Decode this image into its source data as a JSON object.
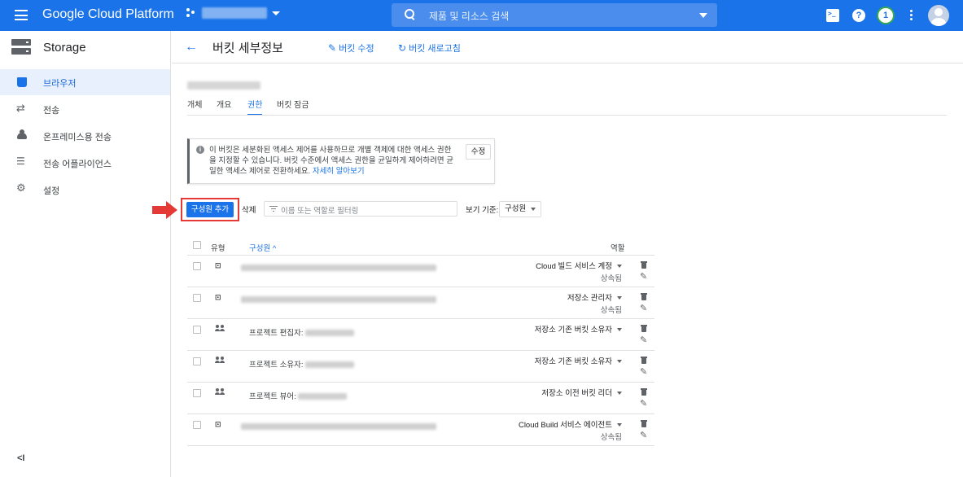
{
  "topbar": {
    "brand": "Google Cloud Platform",
    "search_placeholder": "제품 및 리소스 검색",
    "notification_count": "1",
    "help_label": "?"
  },
  "sidebar": {
    "title": "Storage",
    "items": [
      {
        "label": "브라우저",
        "icon": "bucket-icon",
        "active": true
      },
      {
        "label": "전송",
        "icon": "transfer-icon"
      },
      {
        "label": "온프레미스용 전송",
        "icon": "cloud-upload-icon"
      },
      {
        "label": "전송 어플라이언스",
        "icon": "list-icon"
      },
      {
        "label": "설정",
        "icon": "gear-icon"
      }
    ],
    "collapse_label": "<I"
  },
  "header": {
    "title": "버킷 세부정보",
    "edit_label": "버킷 수정",
    "refresh_label": "버킷 새로고침"
  },
  "tabs": [
    {
      "label": "개체"
    },
    {
      "label": "개요"
    },
    {
      "label": "권한",
      "active": true
    },
    {
      "label": "버킷 잠금"
    }
  ],
  "info": {
    "text": "이 버킷은 세분화된 액세스 제어를 사용하므로 개별 객체에 대한 액세스 권한을 지정할 수 있습니다. 버킷 수준에서 액세스 권한을 균일하게 제어하려면 균일한 액세스 제어로 전환하세요.",
    "link": "자세히 알아보기",
    "edit_button": "수정"
  },
  "toolbar": {
    "add_member": "구성원 추가",
    "delete": "삭제",
    "filter_placeholder": "이름 또는 역할로 필터링",
    "view_label": "보기 기준:",
    "view_value": "구성원"
  },
  "table": {
    "headers": {
      "type": "유형",
      "member": "구성원",
      "sort_indicator": "^",
      "role": "역할"
    },
    "rows": [
      {
        "type": "service-account",
        "member": "",
        "role": "Cloud 빌드 서비스 계정",
        "inherited": "상속됨"
      },
      {
        "type": "service-account",
        "member": "",
        "role": "저장소 관리자",
        "inherited": "상속됨"
      },
      {
        "type": "group",
        "member": "프로젝트 편집자:",
        "role": "저장소 기존 버킷 소유자",
        "inherited": ""
      },
      {
        "type": "group",
        "member": "프로젝트 소유자:",
        "role": "저장소 기존 버킷 소유자",
        "inherited": ""
      },
      {
        "type": "group",
        "member": "프로젝트 뷰어:",
        "role": "저장소 이전 버킷 리더",
        "inherited": ""
      },
      {
        "type": "service-account",
        "member": "",
        "role": "Cloud Build 서비스 에이전트",
        "inherited": "상속됨"
      }
    ]
  },
  "colors": {
    "primary": "#1a73e8",
    "highlight": "#e53935"
  }
}
